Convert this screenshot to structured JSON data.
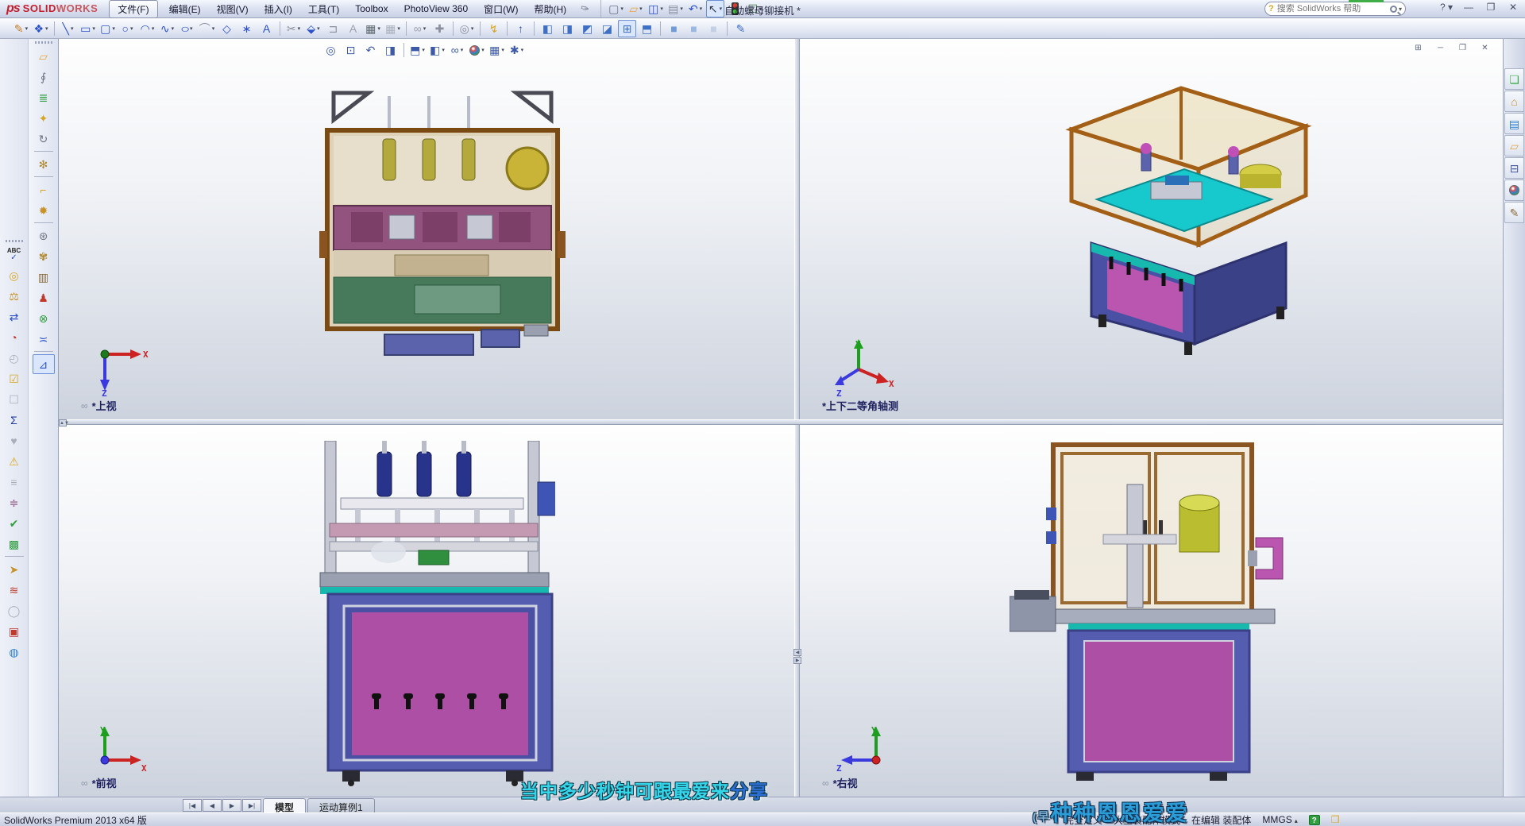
{
  "app": {
    "logo_ds": "ps",
    "logo_solid": "SOLID",
    "logo_works": "WORKS",
    "document_title": "自动螺母铆接机 *",
    "search_placeholder": "搜索 SolidWorks 帮助",
    "search_hint_glyph": "?",
    "pin_glyph": "✑"
  },
  "menus": [
    {
      "id": "file",
      "label": "文件(F)",
      "boxed": true
    },
    {
      "id": "edit",
      "label": "编辑(E)"
    },
    {
      "id": "view",
      "label": "视图(V)"
    },
    {
      "id": "insert",
      "label": "插入(I)"
    },
    {
      "id": "tools",
      "label": "工具(T)"
    },
    {
      "id": "toolbox",
      "label": "Toolbox"
    },
    {
      "id": "photoview-360",
      "label": "PhotoView 360"
    },
    {
      "id": "window",
      "label": "窗口(W)"
    },
    {
      "id": "help",
      "label": "帮助(H)"
    }
  ],
  "quick_toolbar": [
    {
      "name": "new-document",
      "glyph": "▢",
      "color": "#6a7188",
      "dd": true
    },
    {
      "name": "open-document",
      "glyph": "▱",
      "color": "#e8a33d",
      "dd": true
    },
    {
      "name": "save",
      "glyph": "◫",
      "color": "#2b50c8",
      "dd": true
    },
    {
      "name": "print",
      "glyph": "▤",
      "color": "#8a8f9e",
      "dd": true
    },
    {
      "name": "undo",
      "glyph": "↶",
      "color": "#2b50c8",
      "dd": true
    },
    {
      "name": "select-cursor",
      "glyph": "↖",
      "color": "#333a4c",
      "dd": true,
      "pressed": true
    },
    {
      "name": "traffic-light",
      "traffic": true
    },
    {
      "name": "options",
      "glyph": "☑",
      "color": "#3f7a3a",
      "dd": true
    }
  ],
  "window_buttons": [
    {
      "name": "help-menu",
      "glyph": "?",
      "dd": true
    },
    {
      "name": "minimize",
      "glyph": "—"
    },
    {
      "name": "restore",
      "glyph": "❐"
    },
    {
      "name": "close",
      "glyph": "✕"
    }
  ],
  "main_toolbar": [
    {
      "name": "sketch",
      "glyph": "✎",
      "color": "#c77d2a",
      "dd": true
    },
    {
      "name": "sketch-eraser",
      "glyph": "❖",
      "color": "#2b50c8",
      "dd": true
    },
    {
      "sep": true
    },
    {
      "name": "line",
      "glyph": "╲",
      "color": "#2b50c8",
      "dd": true
    },
    {
      "name": "corner-rectangle",
      "glyph": "▭",
      "color": "#2b50c8",
      "dd": true
    },
    {
      "name": "straight-slot",
      "glyph": "▢",
      "color": "#2b50c8",
      "dd": true
    },
    {
      "name": "circle",
      "glyph": "○",
      "color": "#2b50c8",
      "dd": true
    },
    {
      "name": "arc",
      "glyph": "◠",
      "color": "#2b50c8",
      "dd": true
    },
    {
      "name": "spline",
      "glyph": "∿",
      "color": "#2b50c8",
      "dd": true
    },
    {
      "name": "ellipse",
      "glyph": "○",
      "color": "#2b50c8",
      "dd": true,
      "wide": true
    },
    {
      "name": "sketch-fillet",
      "glyph": "⌒",
      "color": "#8a8f9e",
      "dd": true
    },
    {
      "name": "polygon",
      "glyph": "◇",
      "color": "#2b50c8"
    },
    {
      "name": "point",
      "glyph": "∗",
      "color": "#2b50c8"
    },
    {
      "name": "text",
      "glyph": "A",
      "color": "#2b50c8"
    },
    {
      "sep": true
    },
    {
      "name": "trim-entities",
      "glyph": "✂",
      "color": "#8a8f9e",
      "dd": true
    },
    {
      "name": "convert-entities",
      "glyph": "⬙",
      "color": "#2b50c8",
      "dd": true
    },
    {
      "name": "offset-entities",
      "glyph": "⊐",
      "color": "#8a8f9e"
    },
    {
      "name": "sketch-warning",
      "glyph": "A",
      "color": "#9aa0ad"
    },
    {
      "name": "linear-sketch-pattern",
      "glyph": "▦",
      "color": "#5b666e",
      "dd": true
    },
    {
      "name": "pattern-secondary",
      "glyph": "▦",
      "color": "#aab0bc",
      "dd": true
    },
    {
      "sep": true
    },
    {
      "name": "display-relations",
      "glyph": "∞",
      "color": "#9aa0ad",
      "dd": true
    },
    {
      "name": "repair-sketch",
      "glyph": "✚",
      "color": "#8a8f9e"
    },
    {
      "sep": true
    },
    {
      "name": "quick-snaps",
      "glyph": "◎",
      "color": "#8a8f9e",
      "dd": true
    },
    {
      "sep": true
    },
    {
      "name": "instant-3d",
      "glyph": "↯",
      "color": "#d9a520"
    },
    {
      "sep": true
    },
    {
      "name": "normal-to",
      "glyph": "↑",
      "color": "#2b50c8"
    },
    {
      "sep": true
    },
    {
      "name": "view-front",
      "glyph": "◧",
      "color": "#3d6fc4"
    },
    {
      "name": "view-back",
      "glyph": "◨",
      "color": "#3d6fc4"
    },
    {
      "name": "view-left",
      "glyph": "◩",
      "color": "#3d6fc4"
    },
    {
      "name": "view-right",
      "glyph": "◪",
      "color": "#3d6fc4"
    },
    {
      "name": "four-viewport",
      "glyph": "⊞",
      "color": "#3d6fc4",
      "pressed": true
    },
    {
      "name": "view-isometric",
      "glyph": "⬒",
      "color": "#3d6fc4"
    },
    {
      "sep": true
    },
    {
      "name": "shaded-with-edges",
      "glyph": "■",
      "color": "#6f9bd9"
    },
    {
      "name": "shaded",
      "glyph": "■",
      "color": "#9cb8e0"
    },
    {
      "name": "wireframe",
      "glyph": "■",
      "color": "#c2cfe4"
    },
    {
      "sep": true
    },
    {
      "name": "appearance-pen",
      "glyph": "✎",
      "color": "#3d6fc4"
    }
  ],
  "left_col_a": [
    {
      "name": "spell-check",
      "abc": true
    },
    {
      "name": "measure-tape",
      "glyph": "◎",
      "color": "#d9a520"
    },
    {
      "name": "mass-properties",
      "glyph": "⚖",
      "color": "#c8922b"
    },
    {
      "name": "section-properties",
      "glyph": "⇄",
      "color": "#2b50c8"
    },
    {
      "name": "sensor",
      "glyph": "◔",
      "color": "#c0392b"
    },
    {
      "name": "stopwatch",
      "glyph": "◴",
      "color": "#9aa0ad",
      "disabled": true
    },
    {
      "name": "design-checker",
      "glyph": "☑",
      "color": "#d9a520"
    },
    {
      "name": "design-checker-inactive",
      "glyph": "☐",
      "color": "#aab0bc",
      "disabled": true
    },
    {
      "name": "equations",
      "glyph": "Σ",
      "color": "#1f3aa0"
    },
    {
      "name": "deviation-analysis",
      "glyph": "♥",
      "color": "#b7bcc8",
      "disabled": true
    },
    {
      "name": "import-diagnostics",
      "glyph": "⚠",
      "color": "#d9a520"
    },
    {
      "name": "compress",
      "glyph": "≡",
      "color": "#aab0bc",
      "disabled": true
    },
    {
      "name": "compare-documents",
      "glyph": "≑",
      "color": "#8a4b7c"
    },
    {
      "name": "verification",
      "glyph": "✔",
      "color": "#2f9e3f"
    },
    {
      "name": "delete-table",
      "glyph": "▩",
      "color": "#2f9e3f"
    },
    {
      "sep": true
    },
    {
      "name": "search-select",
      "glyph": "➤",
      "color": "#c8922b"
    },
    {
      "name": "exploded-layers",
      "glyph": "≋",
      "color": "#c0392b"
    },
    {
      "name": "accept-circle",
      "glyph": "◯",
      "color": "#b7bcc8",
      "disabled": true
    },
    {
      "name": "overlap-squares",
      "glyph": "▣",
      "color": "#c0392b"
    },
    {
      "name": "globe",
      "glyph": "◍",
      "color": "#2b7fd0"
    }
  ],
  "left_col_b": [
    {
      "name": "insert-components",
      "glyph": "▱",
      "color": "#e8a33d"
    },
    {
      "name": "attachment-clip",
      "glyph": "∮",
      "color": "#707685"
    },
    {
      "name": "mate",
      "glyph": "≣",
      "color": "#2f9e3f"
    },
    {
      "name": "smart-fasteners",
      "glyph": "✦",
      "color": "#d9a520"
    },
    {
      "name": "rotate-component",
      "glyph": "↻",
      "color": "#707685"
    },
    {
      "sep": true
    },
    {
      "name": "move-component",
      "glyph": "✻",
      "color": "#b08830"
    },
    {
      "sep": true
    },
    {
      "name": "corner-move",
      "glyph": "⌐",
      "color": "#d9a520"
    },
    {
      "name": "exploded-view",
      "glyph": "✹",
      "color": "#c8922b"
    },
    {
      "sep": true
    },
    {
      "name": "belt-chain",
      "glyph": "⊛",
      "color": "#707685"
    },
    {
      "name": "gear-drive",
      "glyph": "✾",
      "color": "#b08830"
    },
    {
      "name": "assembly-toolbox",
      "glyph": "▥",
      "color": "#8a6a3a"
    },
    {
      "name": "interference-person",
      "glyph": "♟",
      "color": "#c0392b"
    },
    {
      "name": "collision-detection",
      "glyph": "⊗",
      "color": "#2f9e3f"
    },
    {
      "name": "align-components",
      "glyph": "≍",
      "color": "#2b50c8"
    },
    {
      "sep": true
    },
    {
      "name": "measure-tool",
      "glyph": "⊿",
      "color": "#2b50c8",
      "pressed": true
    }
  ],
  "headsup": [
    {
      "name": "zoom-to-fit",
      "glyph": "◎"
    },
    {
      "name": "zoom-to-area",
      "glyph": "⊡"
    },
    {
      "name": "previous-view",
      "glyph": "↶"
    },
    {
      "name": "section-view",
      "glyph": "◨"
    },
    {
      "sep": true
    },
    {
      "name": "view-orientation",
      "glyph": "⬒",
      "dd": true
    },
    {
      "name": "display-style",
      "glyph": "◧",
      "dd": true
    },
    {
      "name": "hide-show-items",
      "glyph": "∞",
      "dd": true
    },
    {
      "name": "edit-appearance",
      "sphere": true,
      "dd": true
    },
    {
      "name": "apply-scene",
      "glyph": "▦",
      "dd": true
    },
    {
      "name": "view-settings",
      "glyph": "✱",
      "dd": true
    }
  ],
  "vp_window_buttons": [
    {
      "name": "viewport-layout",
      "glyph": "⊞"
    },
    {
      "name": "doc-minimize",
      "glyph": "─"
    },
    {
      "name": "doc-restore",
      "glyph": "❐"
    },
    {
      "name": "doc-close",
      "glyph": "✕"
    }
  ],
  "task_pane": [
    {
      "name": "comments",
      "glyph": "❏",
      "color": "#3fae49"
    },
    {
      "name": "resources-home",
      "glyph": "⌂",
      "color": "#c8922b"
    },
    {
      "name": "design-library",
      "glyph": "▤",
      "color": "#2b7fd0"
    },
    {
      "name": "file-explorer",
      "glyph": "▱",
      "color": "#e8a33d"
    },
    {
      "name": "view-palette",
      "glyph": "⊟",
      "color": "#4a5a9e"
    },
    {
      "name": "appearances",
      "sphere": true
    },
    {
      "name": "custom-properties",
      "glyph": "✎",
      "color": "#8a6a3a"
    }
  ],
  "viewports": [
    {
      "label": "*上视",
      "link": true
    },
    {
      "label": "*上下二等角轴测",
      "link": false
    },
    {
      "label": "*前视",
      "link": true
    },
    {
      "label": "*右视",
      "link": true
    }
  ],
  "axes": {
    "x": "X",
    "y": "Y",
    "z": "Z"
  },
  "tab_nav": [
    {
      "name": "tab-scroll-first",
      "glyph": "|◀"
    },
    {
      "name": "tab-scroll-prev",
      "glyph": "◀"
    },
    {
      "name": "tab-scroll-next",
      "glyph": "▶"
    },
    {
      "name": "tab-scroll-last",
      "glyph": "▶|"
    }
  ],
  "tabs": [
    {
      "name": "tab-model",
      "label": "模型",
      "active": true
    },
    {
      "name": "tab-motion-study",
      "label": "运动算例1",
      "active": false
    }
  ],
  "statusbar": {
    "left": "SolidWorks Premium 2013 x64 版",
    "items": [
      {
        "name": "fully-defined",
        "label": "完全定义"
      },
      {
        "name": "large-assembly-mode",
        "label": "大型装配体模式"
      },
      {
        "name": "editing-state",
        "label": "在编辑 装配体"
      },
      {
        "name": "units",
        "label": "MMGS",
        "dd": "▴"
      }
    ],
    "help_glyph": "?",
    "tag_glyph": "❒"
  },
  "subtitles": {
    "line1_main": "当中多少秒钟可跟最爱来",
    "line1_tail": "分享",
    "line2_prefix": "(早",
    "line2": "种种恩恩爱爱"
  }
}
